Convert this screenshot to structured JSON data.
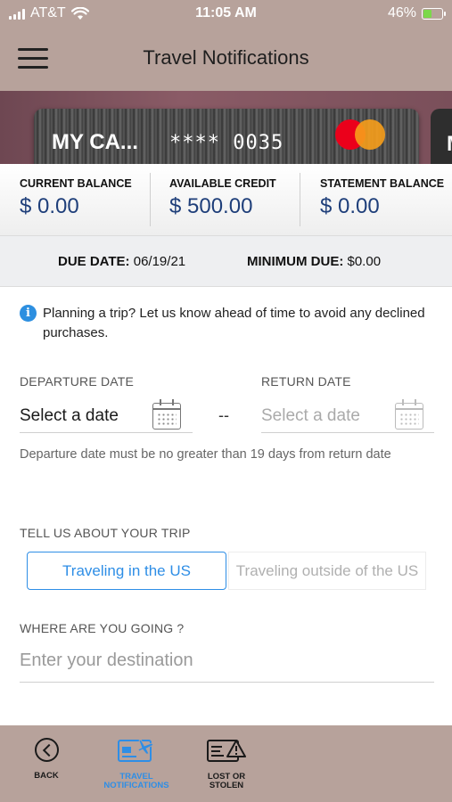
{
  "status_bar": {
    "carrier": "AT&T",
    "time": "11:05 AM",
    "battery": "46%",
    "battery_level": 0.46
  },
  "header": {
    "title": "Travel Notifications"
  },
  "card": {
    "name": "MY CA...",
    "number": "**** 0035",
    "next_card_name": "M"
  },
  "balances": {
    "current_label": "CURRENT BALANCE",
    "current_value": "$ 0.00",
    "available_label": "AVAILABLE CREDIT",
    "available_value": "$ 500.00",
    "statement_label": "STATEMENT BALANCE",
    "statement_value": "$ 0.00"
  },
  "due": {
    "due_date_label": "DUE DATE:",
    "due_date_value": "06/19/21",
    "min_due_label": "MINIMUM DUE:",
    "min_due_value": "$0.00"
  },
  "info": {
    "text": "Planning a trip? Let us know ahead of time to avoid any declined purchases."
  },
  "dates": {
    "departure_label": "DEPARTURE DATE",
    "departure_value": "Select a date",
    "separator": "--",
    "return_label": "RETURN DATE",
    "return_placeholder": "Select a date",
    "hint": "Departure date must be no greater than 19 days from return date"
  },
  "trip": {
    "label": "TELL US ABOUT YOUR TRIP",
    "options": [
      "Traveling in the US",
      "Traveling outside of the US"
    ],
    "selected": "Traveling in the US"
  },
  "destination": {
    "label": "WHERE ARE YOU GOING ?",
    "placeholder": "Enter your destination"
  },
  "bottom_nav": {
    "back": "BACK",
    "travel_line1": "TRAVEL",
    "travel_line2": "NOTIFICATIONS",
    "lost_line1": "LOST OR",
    "lost_line2": "STOLEN"
  },
  "colors": {
    "header_bg": "#b7a29b",
    "accent_blue": "#2e8ee6",
    "balance_blue": "#1f3f7a"
  }
}
